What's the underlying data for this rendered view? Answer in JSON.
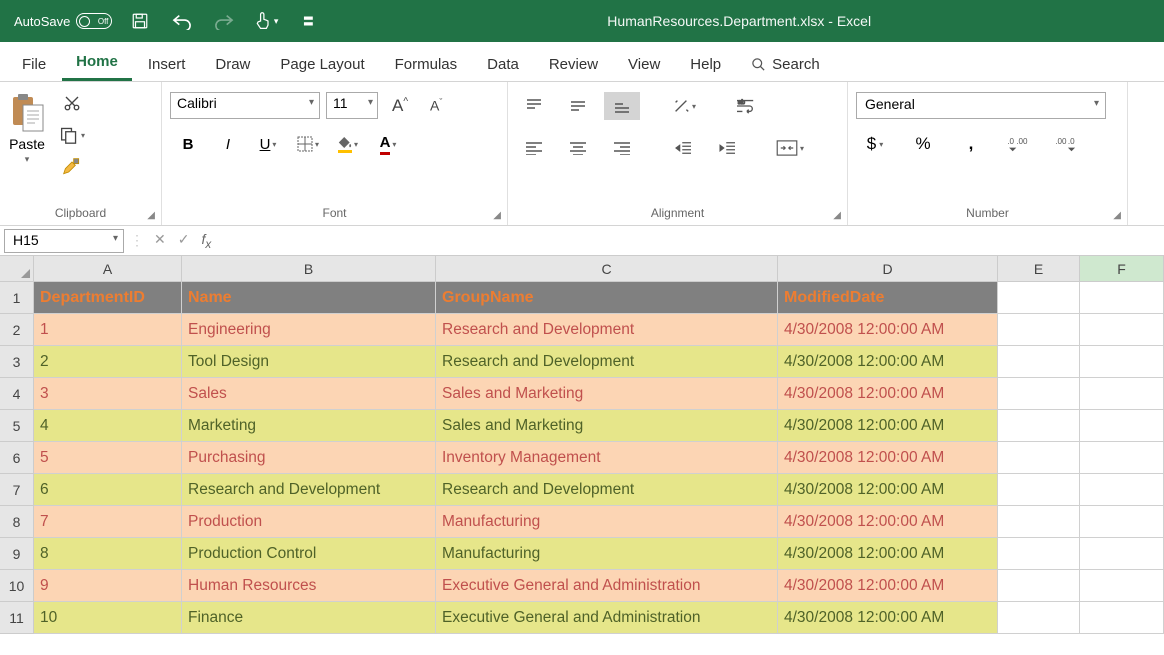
{
  "titlebar": {
    "autosave_label": "AutoSave",
    "autosave_state": "Off",
    "doc_title": "HumanResources.Department.xlsx - Excel"
  },
  "tabs": [
    "File",
    "Home",
    "Insert",
    "Draw",
    "Page Layout",
    "Formulas",
    "Data",
    "Review",
    "View",
    "Help"
  ],
  "active_tab": "Home",
  "search_label": "Search",
  "ribbon": {
    "clipboard": {
      "label": "Clipboard",
      "paste": "Paste"
    },
    "font": {
      "label": "Font",
      "name": "Calibri",
      "size": "11"
    },
    "alignment": {
      "label": "Alignment"
    },
    "number": {
      "label": "Number",
      "format": "General"
    }
  },
  "formula_bar": {
    "cell_ref": "H15",
    "formula": ""
  },
  "columns": [
    "A",
    "B",
    "C",
    "D",
    "E",
    "F"
  ],
  "row_numbers": [
    "1",
    "2",
    "3",
    "4",
    "5",
    "6",
    "7",
    "8",
    "9",
    "10",
    "11"
  ],
  "headers": [
    "DepartmentID",
    "Name",
    "GroupName",
    "ModifiedDate"
  ],
  "rows": [
    [
      "1",
      "Engineering",
      "Research and Development",
      "4/30/2008 12:00:00 AM"
    ],
    [
      "2",
      "Tool Design",
      "Research and Development",
      "4/30/2008 12:00:00 AM"
    ],
    [
      "3",
      "Sales",
      "Sales and Marketing",
      "4/30/2008 12:00:00 AM"
    ],
    [
      "4",
      "Marketing",
      "Sales and Marketing",
      "4/30/2008 12:00:00 AM"
    ],
    [
      "5",
      "Purchasing",
      "Inventory Management",
      "4/30/2008 12:00:00 AM"
    ],
    [
      "6",
      "Research and Development",
      "Research and Development",
      "4/30/2008 12:00:00 AM"
    ],
    [
      "7",
      "Production",
      "Manufacturing",
      "4/30/2008 12:00:00 AM"
    ],
    [
      "8",
      "Production Control",
      "Manufacturing",
      "4/30/2008 12:00:00 AM"
    ],
    [
      "9",
      "Human Resources",
      "Executive General and Administration",
      "4/30/2008 12:00:00 AM"
    ],
    [
      "10",
      "Finance",
      "Executive General and Administration",
      "4/30/2008 12:00:00 AM"
    ]
  ]
}
